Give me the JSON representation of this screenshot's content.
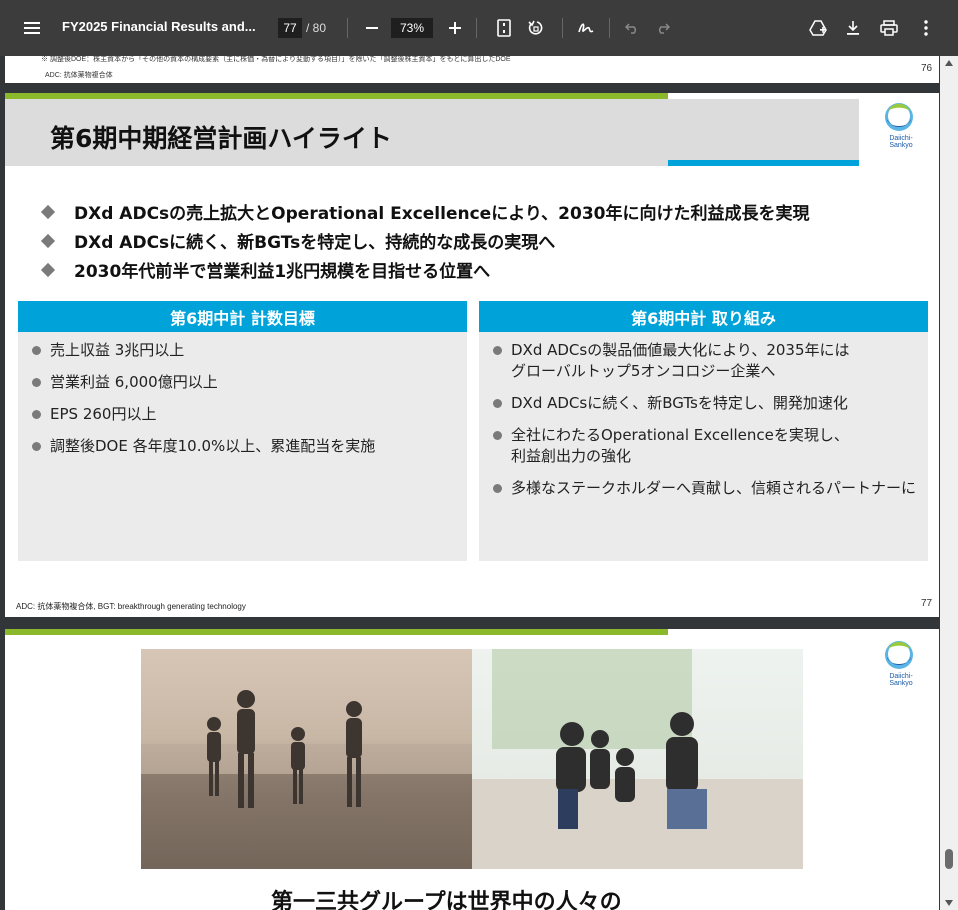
{
  "toolbar": {
    "title": "FY2025 Financial Results and...",
    "current_page": "77",
    "page_total": "/ 80",
    "zoom": "73%"
  },
  "page76": {
    "note_line": "※ 調整後DOE：株主資本から「その他の資本の構成要素（主に株価・為替により変動する項目）」を除いた「調整後株主資本」をもとに算出したDOE",
    "adc_note": "ADC: 抗体薬物複合体",
    "page_number": "76"
  },
  "page77": {
    "title": "第6期中期経営計画ハイライト",
    "logo_text": "Daiichi-Sankyo",
    "highlights": [
      "DXd ADCsの売上拡大とOperational Excellenceにより、2030年に向けた利益成長を実現",
      "DXd ADCsに続く、新BGTsを特定し、持続的な成長の実現へ",
      "2030年代前半で営業利益1兆円規模を目指せる位置へ"
    ],
    "left_panel": {
      "header": "第6期中計 計数目標",
      "items": [
        "売上収益 3兆円以上",
        "営業利益 6,000億円以上",
        "EPS 260円以上",
        "調整後DOE 各年度10.0%以上、累進配当を実施"
      ]
    },
    "right_panel": {
      "header": "第6期中計 取り組み",
      "items": [
        [
          "DXd ADCsの製品価値最大化により、2035年には",
          "グローバルトップ5オンコロジー企業へ"
        ],
        [
          "DXd ADCsに続く、新BGTsを特定し、開発加速化"
        ],
        [
          "全社にわたるOperational Excellenceを実現し、",
          "利益創出力の強化"
        ],
        [
          "多様なステークホルダーへ貢献し、信頼されるパートナーに"
        ]
      ]
    },
    "footnote": "ADC: 抗体薬物複合体, BGT: breakthrough generating technology",
    "page_number": "77"
  },
  "page78": {
    "logo_text": "Daiichi-Sankyo",
    "slogan": "第一三共グループは世界中の人々の"
  },
  "colors": {
    "accent_green": "#8cb82c",
    "accent_blue": "#00a3d9",
    "toolbar_bg": "#3c3c3c"
  }
}
